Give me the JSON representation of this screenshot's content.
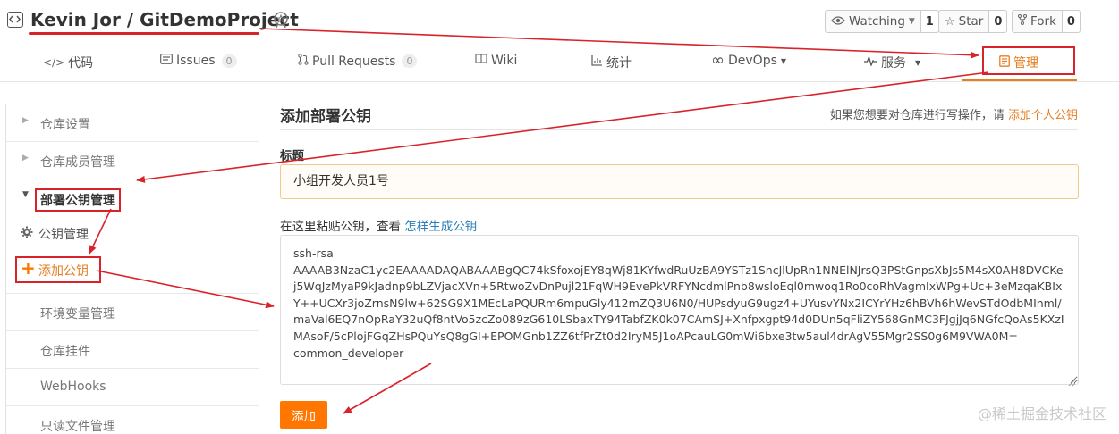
{
  "repo": {
    "title": "Kevin Jor / GitDemoProject"
  },
  "actions": {
    "watch_label": "Watching",
    "watch_count": "1",
    "star_label": "Star",
    "star_count": "0",
    "fork_label": "Fork",
    "fork_count": "0"
  },
  "nav": {
    "code": "代码",
    "issues": "Issues",
    "issues_count": "0",
    "pulls": "Pull Requests",
    "pulls_count": "0",
    "wiki": "Wiki",
    "stats": "统计",
    "devops": "DevOps",
    "services": "服务",
    "manage": "管理"
  },
  "sidebar": {
    "items": [
      {
        "label": "仓库设置"
      },
      {
        "label": "仓库成员管理"
      },
      {
        "label": "部署公钥管理"
      },
      {
        "label": "公钥管理"
      },
      {
        "label": "添加公钥"
      },
      {
        "label": "环境变量管理"
      },
      {
        "label": "仓库挂件"
      },
      {
        "label": "WebHooks"
      },
      {
        "label": "只读文件管理"
      }
    ]
  },
  "main": {
    "title": "添加部署公钥",
    "hint_prefix": "如果您想要对仓库进行写操作，请",
    "hint_link": "添加个人公钥",
    "title_label": "标题",
    "title_value": "小组开发人员1号",
    "paste_prefix": "在这里粘贴公钥，查看",
    "paste_link": "怎样生成公钥",
    "key_value": "ssh-rsa\nAAAAB3NzaC1yc2EAAAADAQABAAABgQC74kSfoxojEY8qWj81KYfwdRuUzBA9YSTz1SncJlUpRn1NNElNJrsQ3PStGnpsXbJs5M4sX0AH8DVCKej5WqJzMyaP9kJadnp9bLZVjacXVn+5RtwoZvDnPujl21FqWH9EvePkVRFYNcdmlPnb8wsloEql0mwoq1Ro0coRhVagmIxWPg+Uc+3eMzqaKBIxY++UCXr3joZrnsN9lw+62SG9X1MEcLaPQURm6mpuGly412mZQ3U6N0/HUPsdyuG9ugz4+UYusvYNx2ICYrYHz6hBVh6hWevSTdOdbMInml/maVal6EQ7nOpRaY32uQf8ntVo5zcZo089zG610LSbaxTY94TabfZK0k07CAmSJ+Xnfpxgpt94d0DUn5qFliZY568GnMC3FJgjJq6NGfcQoAs5KXzIMAsoF/5cPlojFGqZHsPQuYsQ8gGI+EPOMGnb1ZZ6tfPrZt0d2IryM5J1oAPcauLG0mWi6bxe3tw5aul4drAgV55Mgr2SS0g6M9VWA0M=\ncommon_developer",
    "add_button": "添加"
  },
  "watermark": "@稀土掘金技术社区",
  "colors": {
    "accent": "#e67e22",
    "annotation_red": "#d9232b",
    "button_orange": "#ff7700",
    "link_blue": "#2a7fb8"
  }
}
